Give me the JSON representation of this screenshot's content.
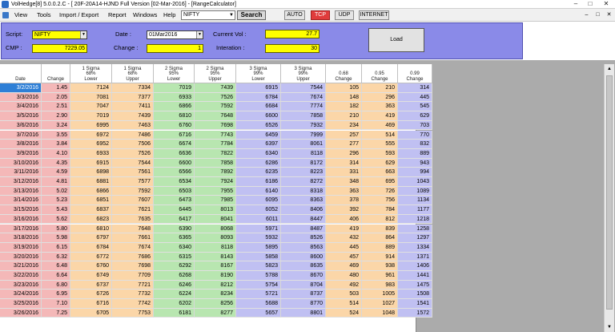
{
  "window": {
    "title": "VolHedge[8] 5.0.0.2.C - [ 20F-20A14-HJND Full Version  [02-Mar-2016] - [RangeCalculator]"
  },
  "menu": {
    "items": [
      "View",
      "Tools",
      "Import / Export",
      "Report",
      "Windows",
      "Help"
    ],
    "symbol_value": "NIFTY",
    "search_label": "Search",
    "mode_buttons": [
      "AUTO",
      "TCP",
      "UDP",
      "INTERNET"
    ],
    "active_mode": "TCP"
  },
  "panel": {
    "script_label": "Script:",
    "script_value": "NIFTY",
    "cmp_label": "CMP :",
    "cmp_value": "7229.05",
    "date_label": "Date :",
    "date_value": "01Mar2016",
    "change_label": "Change :",
    "change_value": "1",
    "curvol_label": "Current Vol :",
    "curvol_value": "27.7",
    "interation_label": "Interation :",
    "interation_value": "30",
    "load_label": "Load"
  },
  "table": {
    "headers": [
      [
        "Date"
      ],
      [
        "Change"
      ],
      [
        "1 Sigma",
        "68%",
        "Lower"
      ],
      [
        "1 Sigma",
        "68%",
        "Upper"
      ],
      [
        "2 Sigma",
        "95%",
        "Lower"
      ],
      [
        "2 Sigma",
        "95%",
        "Upper"
      ],
      [
        "3 Sigma",
        "99%",
        "Lower"
      ],
      [
        "3 Sigma",
        "99%",
        "Upper"
      ],
      [
        "0.68",
        "Change"
      ],
      [
        "0.95",
        "Change"
      ],
      [
        "0.99",
        "Change"
      ]
    ],
    "rows": [
      [
        "3/2/2016",
        "1.45",
        "7124",
        "7334",
        "7019",
        "7439",
        "6915",
        "7544",
        "105",
        "210",
        "314"
      ],
      [
        "3/3/2016",
        "2.05",
        "7081",
        "7377",
        "6933",
        "7526",
        "6784",
        "7674",
        "148",
        "296",
        "445"
      ],
      [
        "3/4/2016",
        "2.51",
        "7047",
        "7411",
        "6866",
        "7592",
        "6684",
        "7774",
        "182",
        "363",
        "545"
      ],
      [
        "3/5/2016",
        "2.90",
        "7019",
        "7439",
        "6810",
        "7648",
        "6600",
        "7858",
        "210",
        "419",
        "629"
      ],
      [
        "3/6/2016",
        "3.24",
        "6995",
        "7463",
        "6760",
        "7698",
        "6526",
        "7932",
        "234",
        "469",
        "703"
      ],
      [
        "3/7/2016",
        "3.55",
        "6972",
        "7486",
        "6716",
        "7743",
        "6459",
        "7999",
        "257",
        "514",
        "770"
      ],
      [
        "3/8/2016",
        "3.84",
        "6952",
        "7506",
        "6674",
        "7784",
        "6397",
        "8061",
        "277",
        "555",
        "832"
      ],
      [
        "3/9/2016",
        "4.10",
        "6933",
        "7526",
        "6636",
        "7822",
        "6340",
        "8118",
        "296",
        "593",
        "889"
      ],
      [
        "3/10/2016",
        "4.35",
        "6915",
        "7544",
        "6600",
        "7858",
        "6286",
        "8172",
        "314",
        "629",
        "943"
      ],
      [
        "3/11/2016",
        "4.59",
        "6898",
        "7561",
        "6566",
        "7892",
        "6235",
        "8223",
        "331",
        "663",
        "994"
      ],
      [
        "3/12/2016",
        "4.81",
        "6881",
        "7577",
        "6534",
        "7924",
        "6186",
        "8272",
        "348",
        "695",
        "1043"
      ],
      [
        "3/13/2016",
        "5.02",
        "6866",
        "7592",
        "6503",
        "7955",
        "6140",
        "8318",
        "363",
        "726",
        "1089"
      ],
      [
        "3/14/2016",
        "5.23",
        "6851",
        "7607",
        "6473",
        "7985",
        "6095",
        "8363",
        "378",
        "756",
        "1134"
      ],
      [
        "3/15/2016",
        "5.43",
        "6837",
        "7621",
        "6445",
        "8013",
        "6052",
        "8406",
        "392",
        "784",
        "1177"
      ],
      [
        "3/16/2016",
        "5.62",
        "6823",
        "7635",
        "6417",
        "8041",
        "6011",
        "8447",
        "406",
        "812",
        "1218"
      ],
      [
        "3/17/2016",
        "5.80",
        "6810",
        "7648",
        "6390",
        "8068",
        "5971",
        "8487",
        "419",
        "839",
        "1258"
      ],
      [
        "3/18/2016",
        "5.98",
        "6797",
        "7661",
        "6365",
        "8093",
        "5932",
        "8526",
        "432",
        "864",
        "1297"
      ],
      [
        "3/19/2016",
        "6.15",
        "6784",
        "7674",
        "6340",
        "8118",
        "5895",
        "8563",
        "445",
        "889",
        "1334"
      ],
      [
        "3/20/2016",
        "6.32",
        "6772",
        "7686",
        "6315",
        "8143",
        "5858",
        "8600",
        "457",
        "914",
        "1371"
      ],
      [
        "3/21/2016",
        "6.48",
        "6760",
        "7698",
        "6292",
        "8167",
        "5823",
        "8635",
        "469",
        "938",
        "1406"
      ],
      [
        "3/22/2016",
        "6.64",
        "6749",
        "7709",
        "6268",
        "8190",
        "5788",
        "8670",
        "480",
        "961",
        "1441"
      ],
      [
        "3/23/2016",
        "6.80",
        "6737",
        "7721",
        "6246",
        "8212",
        "5754",
        "8704",
        "492",
        "983",
        "1475"
      ],
      [
        "3/24/2016",
        "6.95",
        "6726",
        "7732",
        "6224",
        "8234",
        "5721",
        "8737",
        "503",
        "1005",
        "1508"
      ],
      [
        "3/25/2016",
        "7.10",
        "6716",
        "7742",
        "6202",
        "8256",
        "5688",
        "8770",
        "514",
        "1027",
        "1541"
      ],
      [
        "3/26/2016",
        "7.25",
        "6705",
        "7753",
        "6181",
        "8277",
        "5657",
        "8801",
        "524",
        "1048",
        "1572"
      ]
    ],
    "selected_row": 0
  }
}
